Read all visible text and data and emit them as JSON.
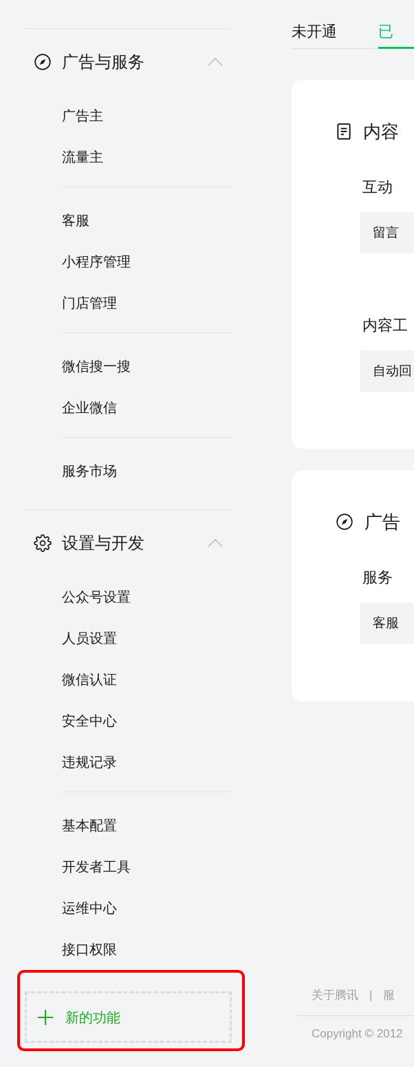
{
  "sidebar": {
    "sections": [
      {
        "title": "广告与服务",
        "expanded": true,
        "groups": [
          {
            "items": [
              {
                "label": "广告主"
              },
              {
                "label": "流量主"
              }
            ]
          },
          {
            "items": [
              {
                "label": "客服"
              },
              {
                "label": "小程序管理"
              },
              {
                "label": "门店管理"
              }
            ]
          },
          {
            "items": [
              {
                "label": "微信搜一搜"
              },
              {
                "label": "企业微信"
              }
            ]
          },
          {
            "items": [
              {
                "label": "服务市场"
              }
            ]
          }
        ]
      },
      {
        "title": "设置与开发",
        "expanded": true,
        "groups": [
          {
            "items": [
              {
                "label": "公众号设置"
              },
              {
                "label": "人员设置"
              },
              {
                "label": "微信认证"
              },
              {
                "label": "安全中心"
              },
              {
                "label": "违规记录"
              }
            ]
          },
          {
            "items": [
              {
                "label": "基本配置"
              },
              {
                "label": "开发者工具"
              },
              {
                "label": "运维中心"
              },
              {
                "label": "接口权限"
              }
            ]
          }
        ]
      }
    ],
    "new_feature_button": {
      "label": "新的功能",
      "highlighted": true
    }
  },
  "tabs": [
    {
      "label": "未开通",
      "selected": false
    },
    {
      "label": "已",
      "selected": true
    }
  ],
  "cards": [
    {
      "title": "内容",
      "sections": [
        {
          "heading": "互动",
          "items": [
            "留言"
          ]
        },
        {
          "heading": "内容工",
          "items": [
            "自动回"
          ]
        }
      ]
    },
    {
      "title": "广告",
      "sections": [
        {
          "heading": "服务",
          "items": [
            "客服"
          ]
        }
      ]
    }
  ],
  "footer": {
    "links": [
      "关于腾讯",
      "服"
    ],
    "separator": "|",
    "copyright": "Copyright © 2012"
  }
}
